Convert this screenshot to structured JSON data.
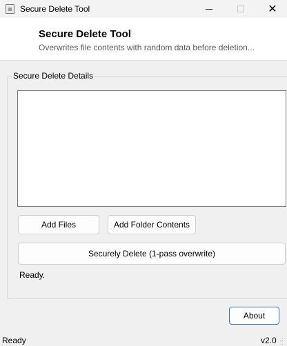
{
  "window": {
    "title": "Secure Delete Tool",
    "close_glyph": "✕"
  },
  "header": {
    "title": "Secure Delete Tool",
    "subtitle": "Overwrites file contents with random data before deletion..."
  },
  "group": {
    "label": "Secure Delete Details",
    "file_list_items": []
  },
  "buttons": {
    "add_files": "Add Files",
    "add_folder": "Add Folder Contents",
    "delete": "Securely Delete (1-pass overwrite)",
    "about": "About"
  },
  "status": {
    "inner": "Ready.",
    "bar_left": "Ready",
    "version": "v2.0"
  },
  "icons": {
    "app": "app-icon",
    "minimize": "minimize-icon",
    "maximize": "maximize-icon",
    "close": "close-icon",
    "grip": "resize-grip-icon"
  }
}
